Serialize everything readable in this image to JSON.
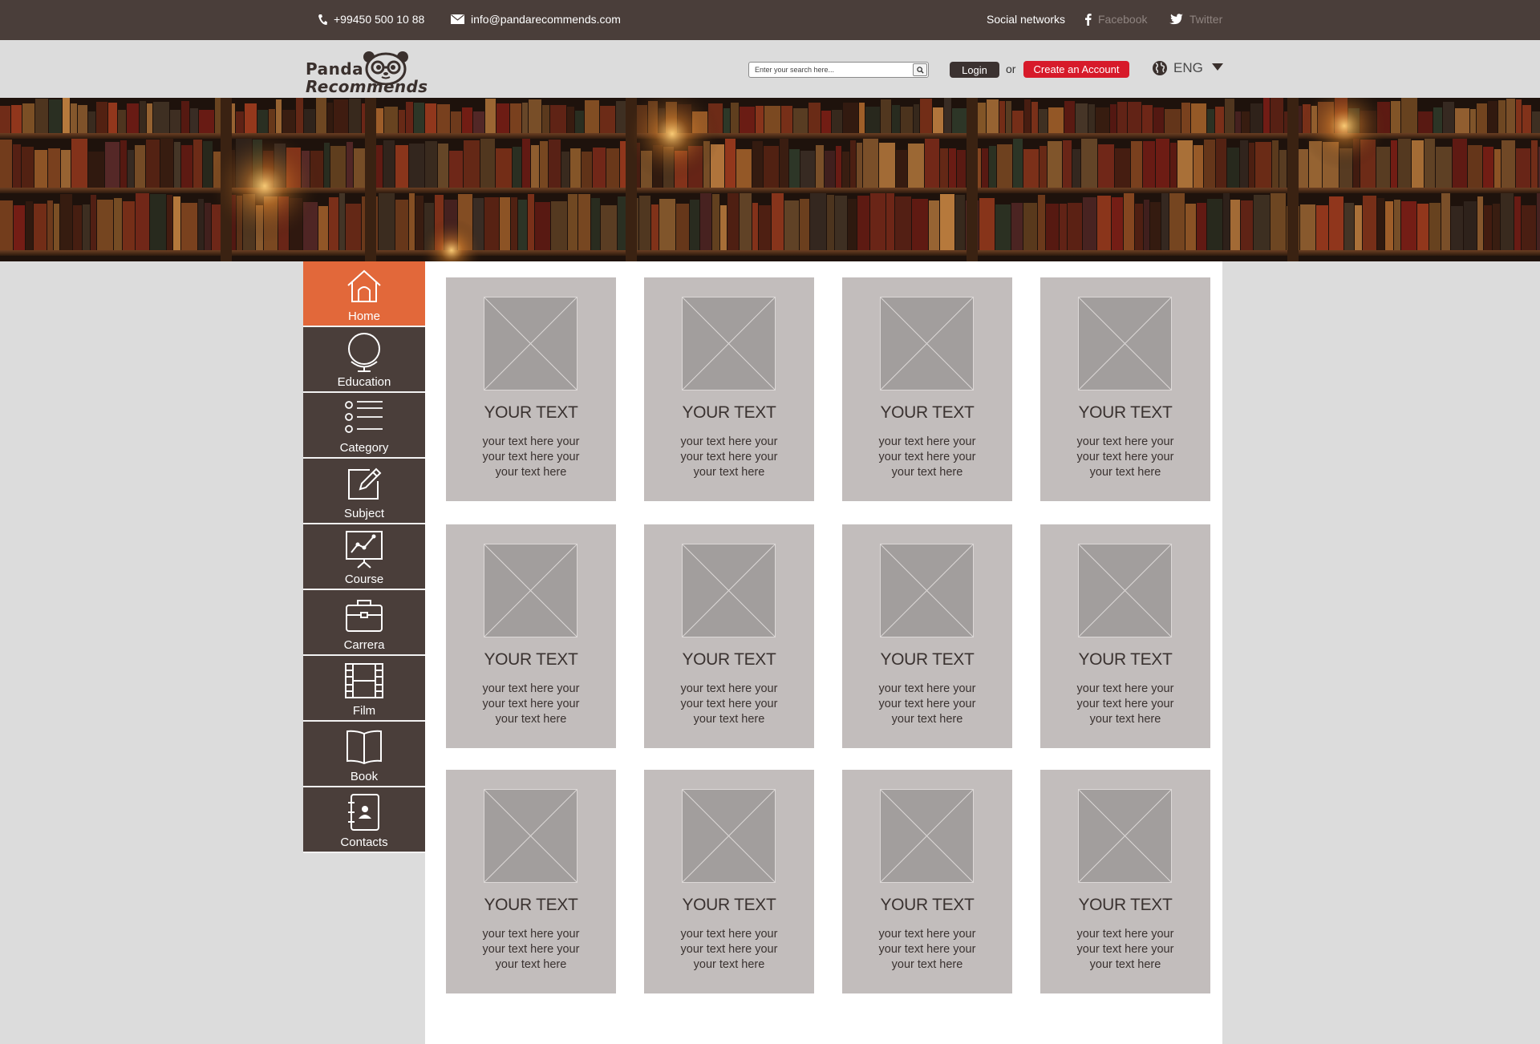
{
  "topbar": {
    "phone": "+99450 500 10 88",
    "email": "info@pandarecommends.com",
    "social_label": "Social networks",
    "facebook": "Facebook",
    "twitter": "Twitter"
  },
  "header": {
    "logo_line1": "Panda",
    "logo_line2": "Recommends",
    "search_placeholder": "Enter your search here...",
    "login_label": "Login",
    "or_label": "or",
    "create_label": "Create an Account",
    "language": "ENG"
  },
  "colors": {
    "topbar_bg": "#4a3e3a",
    "accent_orange": "#e2683a",
    "create_red": "#d71a2a",
    "card_bg": "#c2bdbc",
    "placeholder_bg": "#a29e9d"
  },
  "sidebar": {
    "active_index": 0,
    "items": [
      {
        "label": "Home",
        "icon": "home-icon"
      },
      {
        "label": "Education",
        "icon": "globe-icon"
      },
      {
        "label": "Category",
        "icon": "list-icon"
      },
      {
        "label": "Subject",
        "icon": "pencil-icon"
      },
      {
        "label": "Course",
        "icon": "presentation-chart-icon"
      },
      {
        "label": "Carrera",
        "icon": "briefcase-icon"
      },
      {
        "label": "Film",
        "icon": "film-icon"
      },
      {
        "label": "Book",
        "icon": "book-icon"
      },
      {
        "label": "Contacts",
        "icon": "contact-book-icon"
      }
    ]
  },
  "cards": [
    {
      "title": "YOUR TEXT",
      "lines": [
        "your text here your",
        "your text here your",
        "your text here"
      ]
    },
    {
      "title": "YOUR TEXT",
      "lines": [
        "your text here your",
        "your text here your",
        "your text here"
      ]
    },
    {
      "title": "YOUR TEXT",
      "lines": [
        "your text here your",
        "your text here your",
        "your text here"
      ]
    },
    {
      "title": "YOUR TEXT",
      "lines": [
        "your text here your",
        "your text here your",
        "your text here"
      ]
    },
    {
      "title": "YOUR TEXT",
      "lines": [
        "your text here your",
        "your text here your",
        "your text here"
      ]
    },
    {
      "title": "YOUR TEXT",
      "lines": [
        "your text here your",
        "your text here your",
        "your text here"
      ]
    },
    {
      "title": "YOUR TEXT",
      "lines": [
        "your text here your",
        "your text here your",
        "your text here"
      ]
    },
    {
      "title": "YOUR TEXT",
      "lines": [
        "your text here your",
        "your text here your",
        "your text here"
      ]
    },
    {
      "title": "YOUR TEXT",
      "lines": [
        "your text here your",
        "your text here your",
        "your text here"
      ]
    },
    {
      "title": "YOUR TEXT",
      "lines": [
        "your text here your",
        "your text here your",
        "your text here"
      ]
    },
    {
      "title": "YOUR TEXT",
      "lines": [
        "your text here your",
        "your text here your",
        "your text here"
      ]
    },
    {
      "title": "YOUR TEXT",
      "lines": [
        "your text here your",
        "your text here your",
        "your text here"
      ]
    }
  ]
}
